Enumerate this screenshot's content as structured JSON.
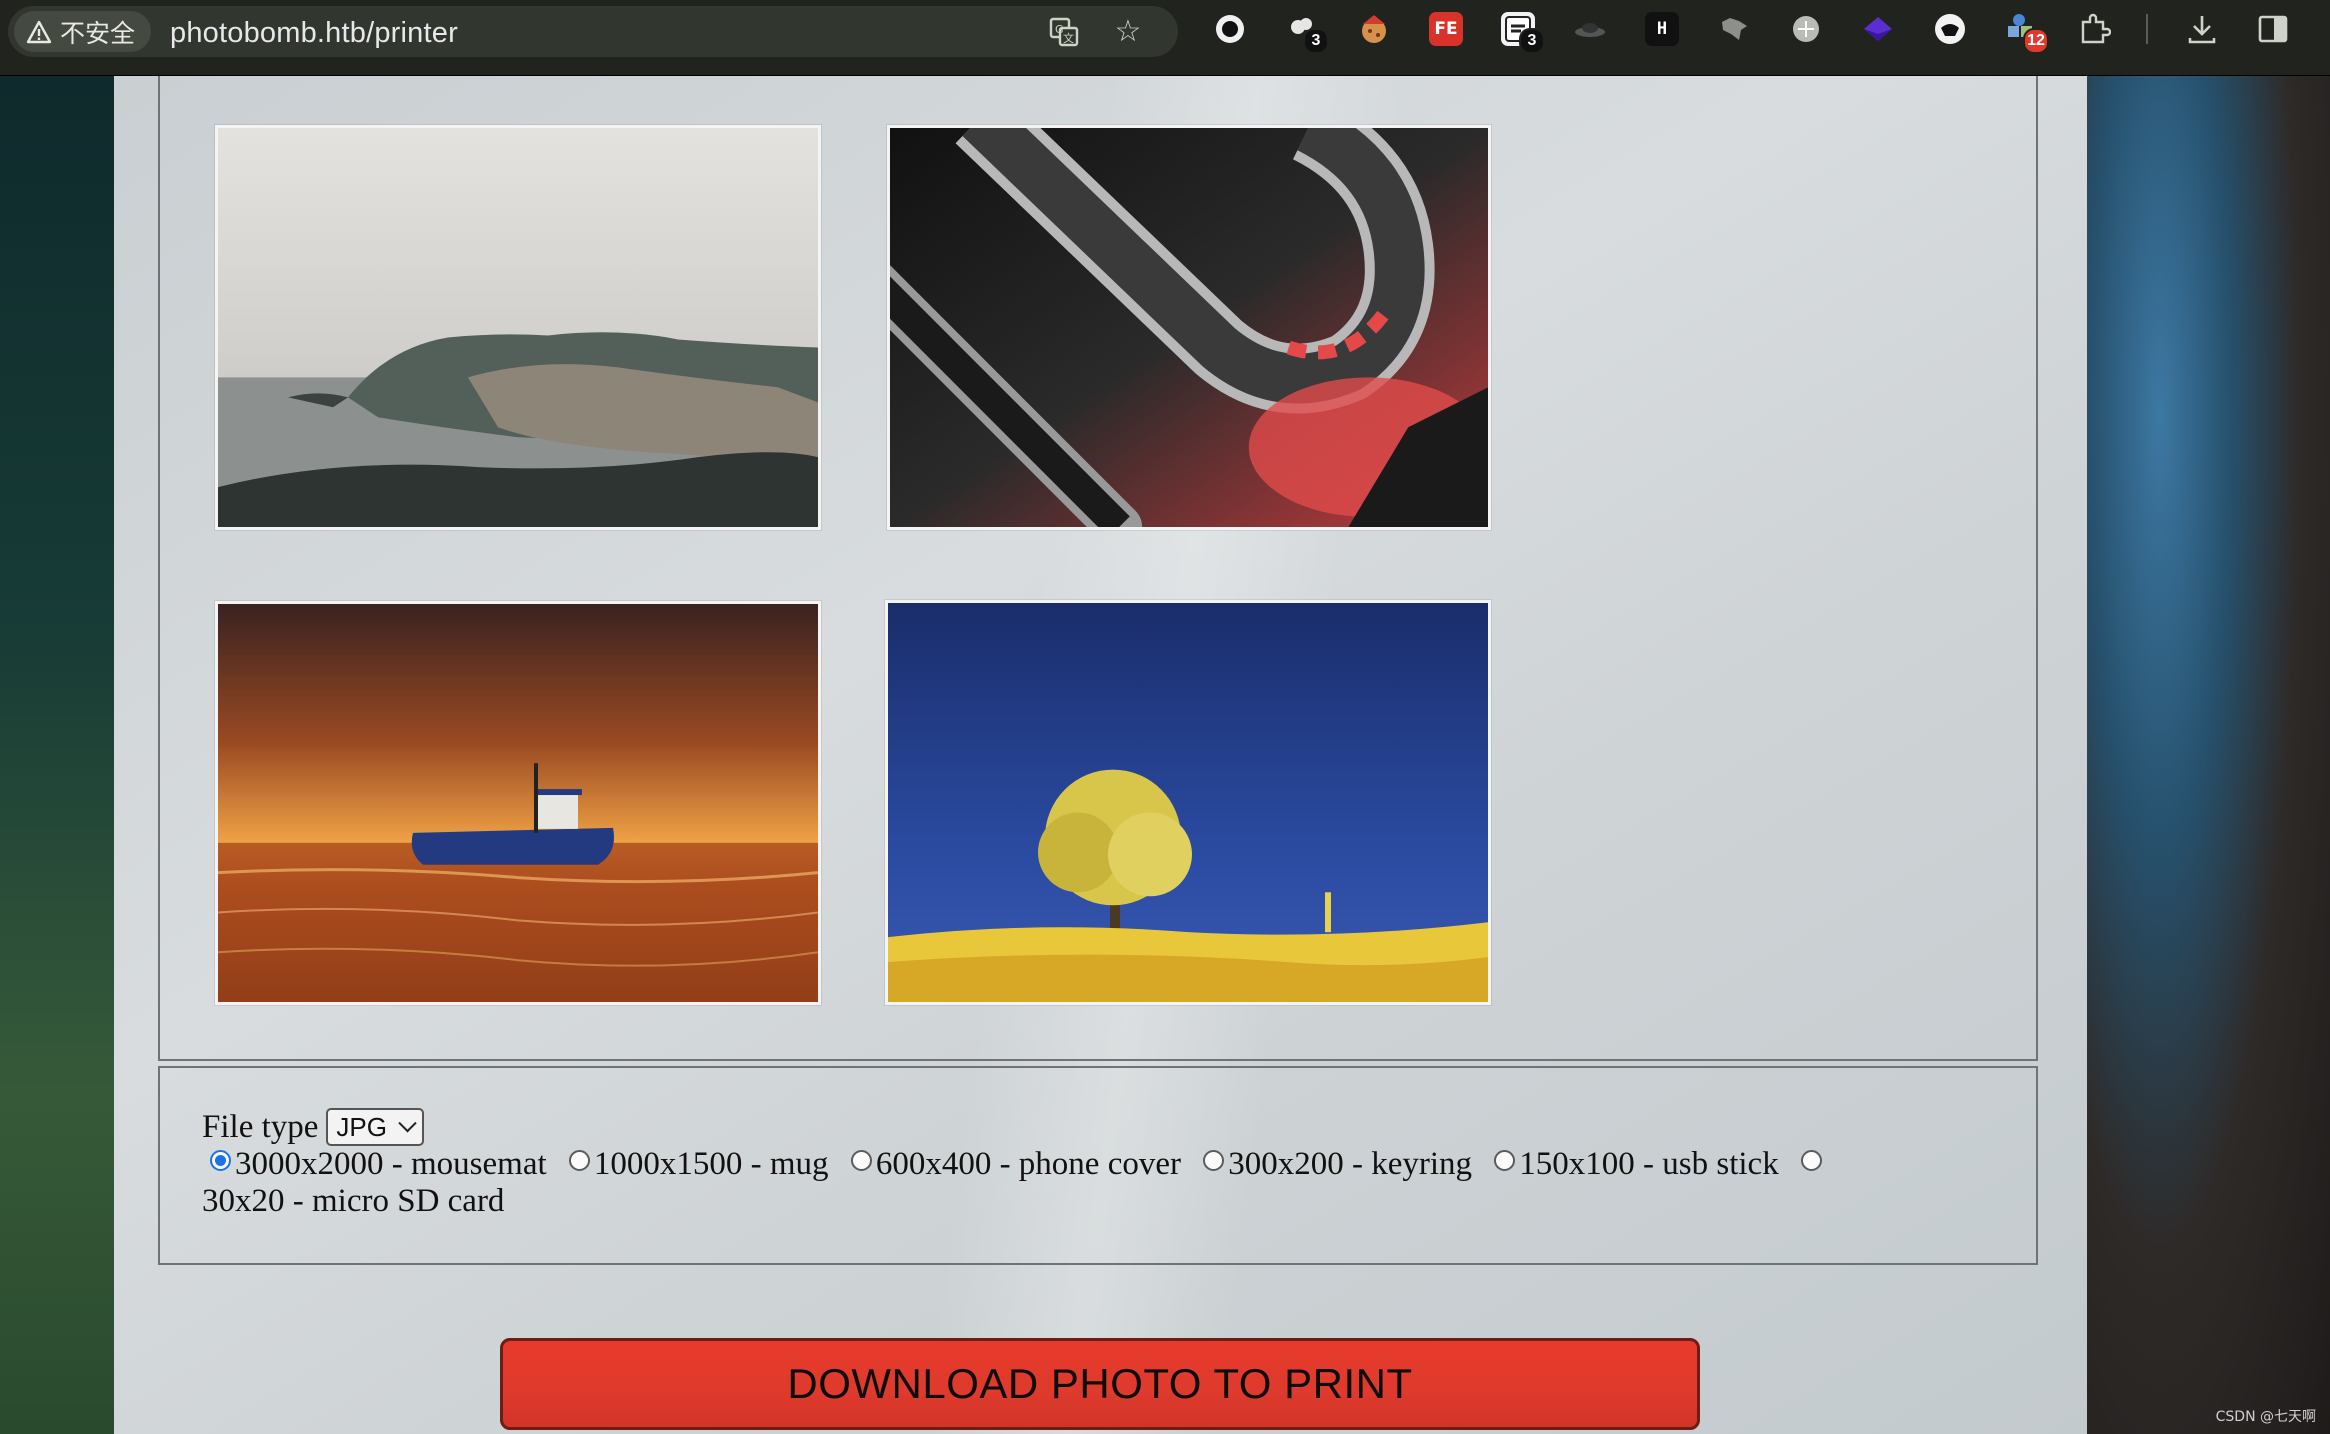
{
  "browser": {
    "security_label": "不安全",
    "url": "photobomb.htb/printer",
    "extensions": [
      {
        "name": "ext-circle",
        "badge": ""
      },
      {
        "name": "ext-cloud",
        "badge": "3"
      },
      {
        "name": "ext-cookie",
        "badge": ""
      },
      {
        "name": "ext-fe",
        "label": "FE",
        "badge": ""
      },
      {
        "name": "ext-clipboard",
        "badge": "3"
      },
      {
        "name": "ext-hat",
        "badge": ""
      },
      {
        "name": "ext-h",
        "label": "H",
        "badge": ""
      },
      {
        "name": "ext-fox",
        "badge": ""
      },
      {
        "name": "ext-globe",
        "badge": ""
      },
      {
        "name": "ext-diamond",
        "badge": ""
      },
      {
        "name": "ext-mask",
        "badge": ""
      },
      {
        "name": "ext-puzzle-multi",
        "badge": "12"
      }
    ]
  },
  "gallery": {
    "photos": [
      {
        "name": "photo-coastal-cliffs"
      },
      {
        "name": "photo-red-abstract-tubes"
      },
      {
        "name": "photo-boat-at-sunset"
      },
      {
        "name": "photo-yellow-tree-blue-sky"
      }
    ]
  },
  "options": {
    "filetype_label": "File type",
    "filetype_value": "JPG",
    "sizes": [
      {
        "label": "3000x2000 - mousemat",
        "checked": true
      },
      {
        "label": "1000x1500 - mug",
        "checked": false
      },
      {
        "label": "600x400 - phone cover",
        "checked": false
      },
      {
        "label": "300x200 - keyring",
        "checked": false
      },
      {
        "label": "150x100 - usb stick",
        "checked": false
      },
      {
        "label": "30x20 - micro SD card",
        "checked": false
      }
    ]
  },
  "download_button": "DOWNLOAD PHOTO TO PRINT",
  "watermark": "CSDN @七天啊",
  "colors": {
    "accent": "#e0392b",
    "radio_accent": "#1a73e8"
  }
}
